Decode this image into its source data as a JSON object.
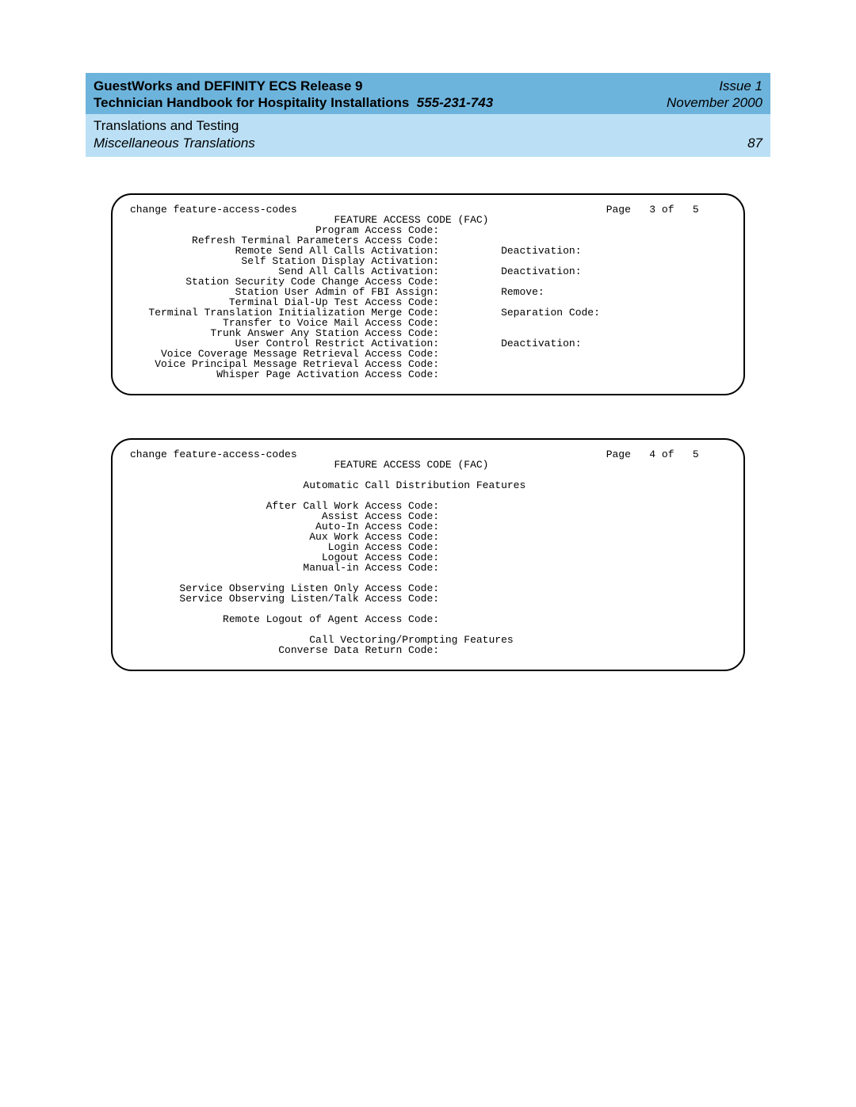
{
  "header": {
    "title_line1_a": "GuestWorks and DEFINITY ECS Release 9",
    "title_line2_a": "Technician Handbook for Hospitality Installations",
    "docnum": "555-231-743",
    "issue": "Issue 1",
    "date": "November 2000",
    "section": "Translations and Testing",
    "subsection": "Miscellaneous Translations",
    "pagenum": "87"
  },
  "screen1": {
    "cmd": "change feature-access-codes",
    "page": "Page   3 of   5",
    "title": "FEATURE ACCESS CODE (FAC)",
    "lines_left": [
      "Program Access Code:",
      "Refresh Terminal Parameters Access Code:",
      "Remote Send All Calls Activation:",
      "Self Station Display Activation:",
      "Send All Calls Activation:",
      "Station Security Code Change Access Code:",
      "Station User Admin of FBI Assign:",
      "Terminal Dial-Up Test Access Code:",
      "Terminal Translation Initialization Merge Code:",
      "Transfer to Voice Mail Access Code:",
      "Trunk Answer Any Station Access Code:",
      "User Control Restrict Activation:",
      "Voice Coverage Message Retrieval Access Code:",
      "Voice Principal Message Retrieval Access Code:",
      "Whisper Page Activation Access Code:"
    ],
    "lines_right": [
      "",
      "",
      "Deactivation:",
      "",
      "Deactivation:",
      "",
      "Remove:",
      "",
      "Separation Code:",
      "",
      "",
      "Deactivation:",
      "",
      "",
      ""
    ]
  },
  "screen2": {
    "cmd": "change feature-access-codes",
    "page": "Page   4 of   5",
    "title": "FEATURE ACCESS CODE (FAC)",
    "sub1": "Automatic Call Distribution Features",
    "lines1": [
      "After Call Work Access Code:",
      "Assist Access Code:",
      "Auto-In Access Code:",
      "Aux Work Access Code:",
      "Login Access Code:",
      "Logout Access Code:",
      "Manual-in Access Code:"
    ],
    "lines2": [
      "Service Observing Listen Only Access Code:",
      "Service Observing Listen/Talk Access Code:"
    ],
    "lines3": [
      "Remote Logout of Agent Access Code:"
    ],
    "sub2": "Call Vectoring/Prompting Features",
    "lines4": [
      "Converse Data Return Code:"
    ]
  }
}
